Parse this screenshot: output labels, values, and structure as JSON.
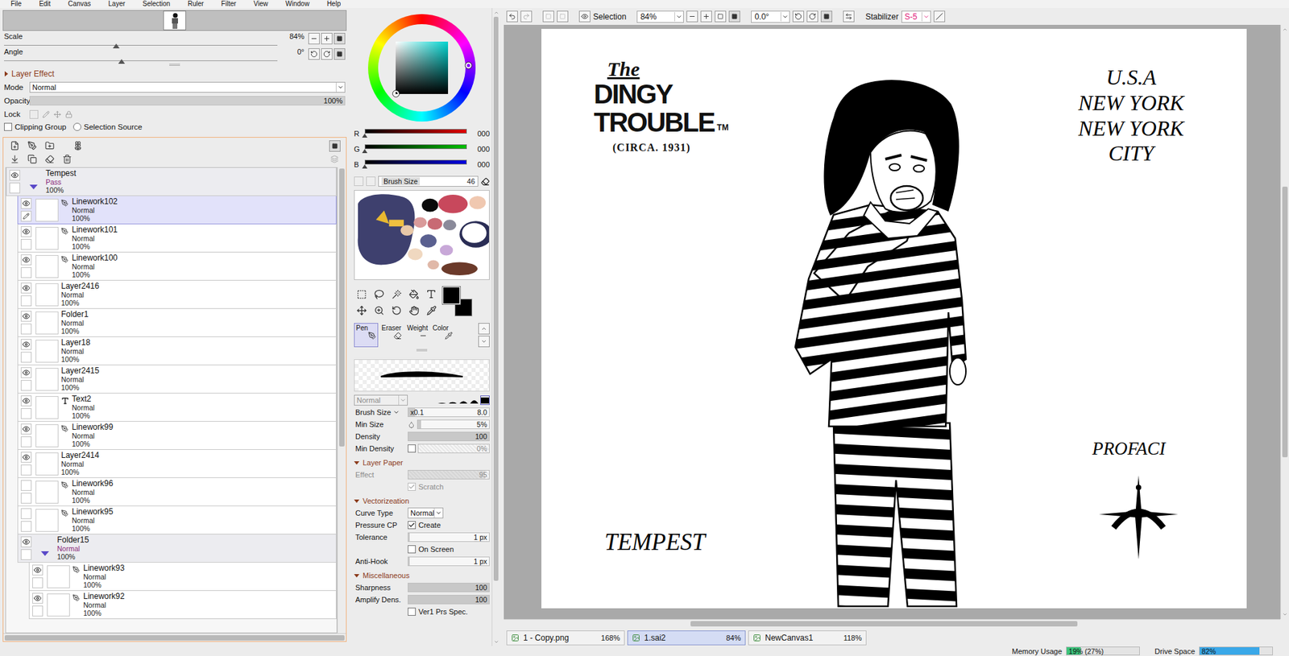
{
  "menu": [
    "File",
    "Edit",
    "Canvas",
    "Layer",
    "Selection",
    "Ruler",
    "Filter",
    "View",
    "Window",
    "Help"
  ],
  "navigator": {
    "scale": {
      "label": "Scale",
      "value": "84%",
      "level": 0.41
    },
    "angle": {
      "label": "Angle",
      "value": "0°",
      "level": 0.43
    }
  },
  "layer_panel": {
    "header": {
      "label": "Layer Effect",
      "expanded": false
    },
    "mode": {
      "label": "Mode",
      "value": "Normal"
    },
    "opacity": {
      "label": "Opacity",
      "value": "100%",
      "level": 1
    },
    "lock": {
      "label": "Lock"
    },
    "checks": [
      {
        "label": "Clipping Group",
        "checked": false,
        "kind": "checkbox"
      },
      {
        "label": "Selection Source",
        "checked": false,
        "kind": "radio"
      }
    ],
    "layers": [
      {
        "name": "Tempest",
        "kind": "folder",
        "mode": "Pass",
        "opacity": "100%",
        "visible": true,
        "selected": false,
        "expanded": true,
        "children": [
          {
            "name": "Linework102",
            "kind": "linework",
            "mode": "Normal",
            "opacity": "100%",
            "visible": true,
            "selected": true
          },
          {
            "name": "Linework101",
            "kind": "linework",
            "mode": "Normal",
            "opacity": "100%",
            "visible": true,
            "selected": false
          },
          {
            "name": "Linework100",
            "kind": "linework",
            "mode": "Normal",
            "opacity": "100%",
            "visible": true,
            "selected": false
          },
          {
            "name": "Layer2416",
            "kind": "layer",
            "mode": "Normal",
            "opacity": "100%",
            "visible": true,
            "selected": false
          },
          {
            "name": "Folder1",
            "kind": "layer",
            "mode": "Normal",
            "opacity": "100%",
            "visible": true,
            "selected": false
          },
          {
            "name": "Layer18",
            "kind": "layer",
            "mode": "Normal",
            "opacity": "100%",
            "visible": true,
            "selected": false
          },
          {
            "name": "Layer2415",
            "kind": "layer",
            "mode": "Normal",
            "opacity": "100%",
            "visible": true,
            "selected": false
          },
          {
            "name": "Text2",
            "kind": "text",
            "mode": "Normal",
            "opacity": "100%",
            "visible": true,
            "selected": false
          },
          {
            "name": "Linework99",
            "kind": "linework",
            "mode": "Normal",
            "opacity": "100%",
            "visible": true,
            "selected": false
          },
          {
            "name": "Layer2414",
            "kind": "layer",
            "mode": "Normal",
            "opacity": "100%",
            "visible": true,
            "selected": false
          },
          {
            "name": "Linework96",
            "kind": "linework",
            "mode": "Normal",
            "opacity": "100%",
            "visible": false,
            "selected": false
          },
          {
            "name": "Linework95",
            "kind": "linework",
            "mode": "Normal",
            "opacity": "100%",
            "visible": false,
            "selected": false
          },
          {
            "name": "Folder15",
            "kind": "folder",
            "mode": "Normal",
            "opacity": "100%",
            "visible": true,
            "selected": false,
            "expanded": true,
            "children": [
              {
                "name": "Linework93",
                "kind": "linework",
                "mode": "Normal",
                "opacity": "100%",
                "visible": true,
                "selected": false
              },
              {
                "name": "Linework92",
                "kind": "linework",
                "mode": "Normal",
                "opacity": "100%",
                "visible": true,
                "selected": false
              }
            ]
          }
        ]
      }
    ]
  },
  "color": {
    "channels": [
      {
        "name": "R",
        "value": "000",
        "level": 0,
        "color": "#e00000"
      },
      {
        "name": "G",
        "value": "000",
        "level": 0,
        "color": "#00c000"
      },
      {
        "name": "B",
        "value": "000",
        "level": 0,
        "color": "#0000e0"
      }
    ],
    "brush_size_box": {
      "label": "Brush Size",
      "value": "46"
    }
  },
  "tool_tabs": [
    {
      "label": "Pen",
      "selected": true
    },
    {
      "label": "Eraser",
      "selected": false
    },
    {
      "label": "Weight",
      "selected": false
    },
    {
      "label": "Color",
      "selected": false
    }
  ],
  "brush": {
    "blend": {
      "value": "Normal",
      "disabled": true
    },
    "tips": [
      {
        "selected": false
      },
      {
        "selected": false
      },
      {
        "selected": false
      },
      {
        "selected": false
      },
      {
        "selected": true
      }
    ],
    "settings": [
      {
        "kind": "sizeslider",
        "label": "Brush Size",
        "prefix": "x0.1",
        "value": "8.0",
        "level": 0.08,
        "disabled": false
      },
      {
        "kind": "pressureslider",
        "label": "Min Size",
        "value": "5%",
        "level": 0.05,
        "disabled": false
      },
      {
        "kind": "slider",
        "label": "Density",
        "value": "100",
        "level": 1,
        "disabled": false
      },
      {
        "kind": "checkslider",
        "label": "Min Density",
        "value": "0%",
        "level": 0,
        "checked": false,
        "disabled": true
      }
    ],
    "sections": [
      {
        "title": "Layer Paper",
        "expanded": true,
        "rows": [
          {
            "kind": "slider",
            "label": "Effect",
            "value": "95",
            "level": 0.95,
            "disabled": true
          },
          {
            "kind": "check",
            "text": "Scratch",
            "checked": true,
            "disabled": true
          }
        ]
      },
      {
        "title": "Vectorizeation",
        "expanded": true,
        "rows": [
          {
            "kind": "select",
            "label": "Curve Type",
            "value": "Normal",
            "disabled": false
          },
          {
            "kind": "check",
            "label": "Pressure CP",
            "text": "Create",
            "checked": true,
            "disabled": false
          },
          {
            "kind": "slider",
            "label": "Tolerance",
            "value": "1 px",
            "level": 0.02,
            "disabled": false
          },
          {
            "kind": "check",
            "text": "On Screen",
            "checked": false,
            "disabled": false
          },
          {
            "kind": "slider",
            "label": "Anti-Hook",
            "value": "1 px",
            "level": 0.02,
            "disabled": false
          }
        ]
      },
      {
        "title": "Miscellaneous",
        "expanded": true,
        "rows": [
          {
            "kind": "slider",
            "label": "Sharpness",
            "value": "100",
            "level": 1,
            "disabled": false
          },
          {
            "kind": "slider",
            "label": "Amplify Dens.",
            "value": "100",
            "level": 1,
            "disabled": false
          },
          {
            "kind": "check",
            "text": "Ver1 Prs Spec.",
            "checked": false,
            "disabled": false
          }
        ]
      }
    ]
  },
  "canvas_toolbar": {
    "selection": {
      "label": "Selection"
    },
    "zoom": "84%",
    "angle": "0.0°",
    "stabilizer": {
      "label": "Stabilizer",
      "value": "S-5"
    }
  },
  "artwork": {
    "logo": {
      "prefix": "The",
      "lines": [
        "DINGY",
        "TROUBLE"
      ],
      "mark": "TM",
      "sub": "(CIRCA. 1931)"
    },
    "location": [
      "U.S.A",
      "NEW YORK",
      "NEW YORK",
      "CITY"
    ],
    "family": "PROFACI",
    "name": "TEMPEST"
  },
  "doc_tabs": [
    {
      "label": "1 - Copy.png",
      "zoom": "168%",
      "selected": false
    },
    {
      "label": "1.sai2",
      "zoom": "84%",
      "selected": true
    },
    {
      "label": "NewCanvas1",
      "zoom": "118%",
      "selected": false
    }
  ],
  "status_bar": [
    {
      "label": "Memory Usage",
      "value": "19% (27%)",
      "level": 0.19,
      "color": "#3cc47c"
    },
    {
      "label": "Drive Space",
      "value": "82%",
      "level": 0.82,
      "color": "#3aa8e8"
    }
  ]
}
